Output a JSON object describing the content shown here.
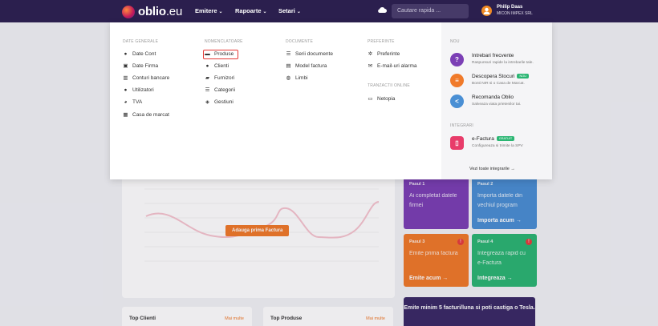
{
  "brand": {
    "name": "oblio",
    "tld": ".eu"
  },
  "topnav": [
    {
      "label": "Emitere",
      "chevron": "⌄"
    },
    {
      "label": "Rapoarte",
      "chevron": "⌄"
    },
    {
      "label": "Setari",
      "chevron": "⌄"
    }
  ],
  "search": {
    "placeholder": "Cautare rapida ..."
  },
  "user": {
    "initial": "",
    "name": "Philip Daas",
    "company": "MICON IMPEX SRL"
  },
  "menu": {
    "columns": [
      {
        "header": "DATE GENERALE",
        "items": [
          {
            "label": "Date Cont",
            "icon": "user-icon"
          },
          {
            "label": "Date Firma",
            "icon": "id-card-icon"
          },
          {
            "label": "Conturi bancare",
            "icon": "bank-icon"
          },
          {
            "label": "Utilizatori",
            "icon": "users-icon"
          },
          {
            "label": "TVA",
            "icon": "pie-icon"
          },
          {
            "label": "Casa de marcat",
            "icon": "calculator-icon"
          }
        ]
      },
      {
        "header": "NOMENCLATOARE",
        "items": [
          {
            "label": "Produse",
            "icon": "box-icon"
          },
          {
            "label": "Clienti",
            "icon": "person-icon"
          },
          {
            "label": "Furnizori",
            "icon": "truck-icon"
          },
          {
            "label": "Categorii",
            "icon": "list-icon"
          },
          {
            "label": "Gestiuni",
            "icon": "layers-icon"
          }
        ]
      },
      {
        "header": "DOCUMENTE",
        "items": [
          {
            "label": "Serii documente",
            "icon": "list-icon"
          },
          {
            "label": "Model factura",
            "icon": "document-icon"
          },
          {
            "label": "Limbi",
            "icon": "globe-icon"
          }
        ]
      },
      {
        "header": "PREFERINTE",
        "items": [
          {
            "label": "Preferinte",
            "icon": "gear-icon"
          },
          {
            "label": "E-mail-uri alarma",
            "icon": "mail-icon"
          }
        ]
      },
      {
        "header": "TRANZACTII ONLINE",
        "items": [
          {
            "label": "Netopia",
            "icon": "card-icon"
          }
        ]
      }
    ],
    "side": {
      "new_header": "NOU",
      "features": [
        {
          "title": "Intrebari frecvente",
          "desc": "Raspunsuri rapide la intrebarile tale.",
          "color": "#7b3fb5",
          "glyph": "?"
        },
        {
          "title": "Descopera Stocuri",
          "desc": "Bonti NIR si o Casa de Marcat.",
          "color": "#f07a2a",
          "glyph": "≡",
          "badge": "NOU",
          "badge_color": "#2bb673"
        },
        {
          "title": "Recomanda Oblio",
          "desc": "Salveaza viata prietenilor tai.",
          "color": "#4a8fd4",
          "glyph": "<"
        }
      ],
      "integrations_header": "INTEGRARI",
      "integration": {
        "title": "e-Factura",
        "desc": "Configureaza si trimite la SPV",
        "color": "#e83c6a",
        "glyph": "▯",
        "badge": "GRATUIT",
        "badge_color": "#2bb673"
      },
      "see_all": "Vezi toate integrarile →"
    }
  },
  "background": {
    "add_invoice": "Adauga prima Factura",
    "steps": [
      {
        "label": "Pasul 1",
        "text": "Ai completat datele firmei",
        "action": "",
        "color": "#7b3fb5"
      },
      {
        "label": "Pasul 2",
        "text": "Importa datele din vechiul program",
        "action": "Importa acum →",
        "color": "#4a8fd4"
      },
      {
        "label": "Pasul 3",
        "text": "Emite prima factura",
        "action": "Emite acum →",
        "color": "#f07a2a"
      },
      {
        "label": "Pasul 4",
        "text": "Integreaza rapid cu e-Factura",
        "action": "Integreaza →",
        "color": "#2bb673"
      }
    ],
    "top_clienti": {
      "title": "Top Clienti",
      "more": "Mai multe"
    },
    "top_produse": {
      "title": "Top Produse",
      "more": "Mai multe"
    },
    "tesla": "Emite minim 5 facturi/luna si poti castiga o Tesla."
  }
}
